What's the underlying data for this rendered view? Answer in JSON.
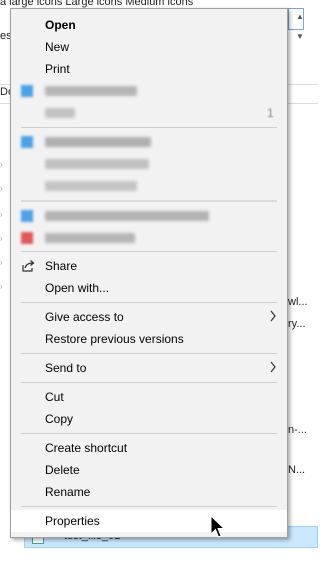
{
  "background": {
    "ribbon_row1": "a large icons       Large icons           Medium icons",
    "ribbon_row2": "es",
    "left_text": "Do",
    "fragments": [
      "wl...",
      "ry...",
      "n-...",
      "N..."
    ],
    "selected_file": "test_file_01"
  },
  "menu": {
    "items": [
      {
        "label": "Open"
      },
      {
        "label": "New"
      },
      {
        "label": "Print"
      },
      {
        "label": "Share"
      },
      {
        "label": "Open with..."
      },
      {
        "label": "Give access to"
      },
      {
        "label": "Restore previous versions"
      },
      {
        "label": "Send to"
      },
      {
        "label": "Cut"
      },
      {
        "label": "Copy"
      },
      {
        "label": "Create shortcut"
      },
      {
        "label": "Delete"
      },
      {
        "label": "Rename"
      },
      {
        "label": "Properties"
      }
    ],
    "blurred_count": "1"
  },
  "colors": {
    "menu_bg": "#f2f2f2",
    "hover_bg": "#ffffff",
    "separator": "#cfcfcf",
    "selection": "#cce8ff",
    "icon_blue": "#4aa3e8",
    "icon_red": "#e05a5a"
  }
}
